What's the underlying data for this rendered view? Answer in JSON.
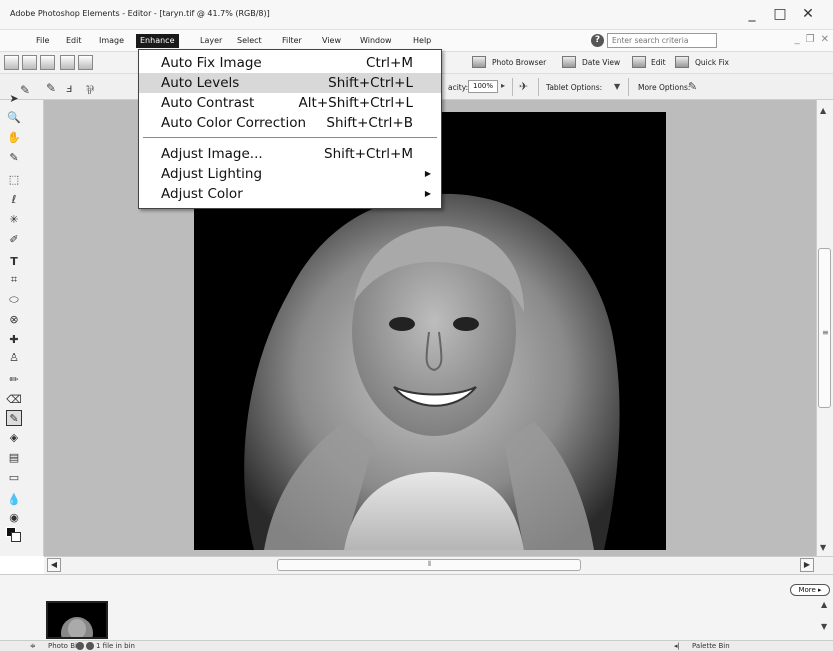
{
  "window": {
    "title": "Adobe Photoshop Elements - Editor - [taryn.tif @ 41.7% (RGB/8)]",
    "controls": [
      "_",
      "□",
      "✕"
    ]
  },
  "menubar": {
    "items": [
      {
        "label": "File"
      },
      {
        "label": "Edit"
      },
      {
        "label": "Image"
      },
      {
        "label": "Enhance",
        "active": true
      },
      {
        "label": "Layer"
      },
      {
        "label": "Select"
      },
      {
        "label": "Filter"
      },
      {
        "label": "View"
      },
      {
        "label": "Window"
      },
      {
        "label": "Help"
      }
    ],
    "search_placeholder": "Enter search criteria"
  },
  "shortcuts_bar": {
    "photo_browser": "Photo Browser",
    "date_view": "Date View",
    "edit": "Edit",
    "quick_fix": "Quick Fix"
  },
  "options_bar": {
    "opacity_label": "acity:",
    "opacity_value": "100%",
    "tablet_options": "Tablet Options:",
    "more_options": "More Options:"
  },
  "enhance_menu": {
    "items": [
      {
        "label": "Auto Fix Image",
        "shortcut": "Ctrl+M"
      },
      {
        "label": "Auto Levels",
        "shortcut": "Shift+Ctrl+L",
        "highlighted": true
      },
      {
        "label": "Auto Contrast",
        "shortcut": "Alt+Shift+Ctrl+L"
      },
      {
        "label": "Auto Color Correction",
        "shortcut": "Shift+Ctrl+B"
      },
      {
        "label": "Adjust Image...",
        "shortcut": "Shift+Ctrl+M"
      },
      {
        "label": "Adjust Lighting",
        "submenu": true
      },
      {
        "label": "Adjust Color",
        "submenu": true
      }
    ]
  },
  "photo_bin": {
    "more_label": "More ▸",
    "status_label": "Photo Bin",
    "file_count": "1 file in bin",
    "palette_bin": "Palette Bin"
  },
  "colors": {
    "accent": "#1a1a1a",
    "workspace": "#bcbcbc",
    "menu_highlight": "#d8d8d8"
  }
}
